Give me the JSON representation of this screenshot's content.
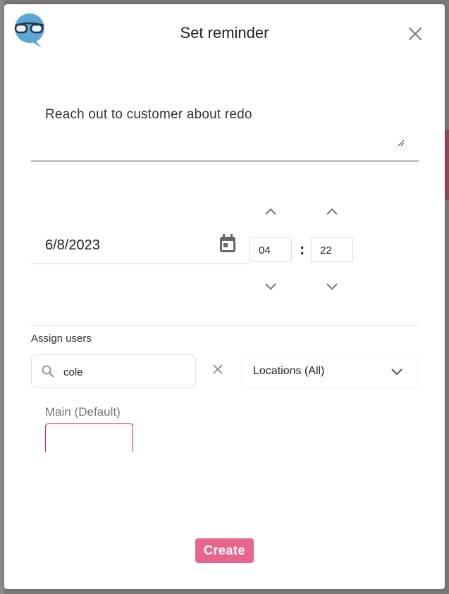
{
  "modal": {
    "title": "Set reminder",
    "logo_icon": "glasses-speech-bubble-icon",
    "close_icon": "close-icon"
  },
  "reminder": {
    "note_text": "Reach out to customer about redo",
    "date_value": "6/8/2023",
    "calendar_icon": "calendar-icon",
    "hour": "04",
    "minute": "22",
    "time_separator": ":"
  },
  "assign": {
    "label": "Assign users",
    "search_value": "cole",
    "search_icon": "search-icon",
    "clear_icon": "clear-icon",
    "locations_selected": "Locations (All)"
  },
  "location_group": {
    "label": "Main (Default)"
  },
  "actions": {
    "create_label": "Create"
  },
  "colors": {
    "primary_button": "#e8668e",
    "logo_blue": "#5aa7d8",
    "location_border": "#b22a48"
  }
}
